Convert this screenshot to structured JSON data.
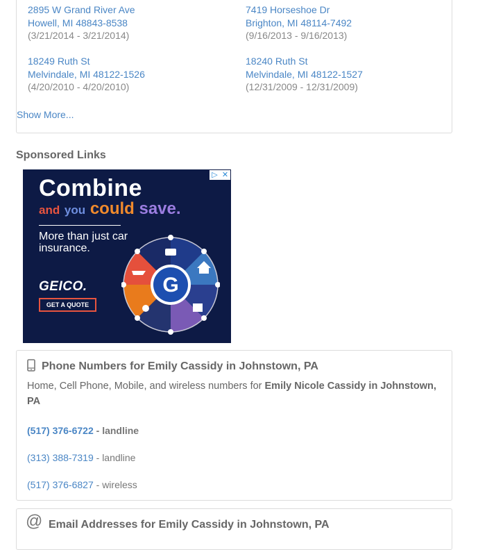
{
  "addresses": [
    {
      "street": "2895 W Grand River Ave",
      "city": "Howell, MI 48843-8538",
      "dates": "(3/21/2014 - 3/21/2014)"
    },
    {
      "street": "7419 Horseshoe Dr",
      "city": "Brighton, MI 48114-7492",
      "dates": "(9/16/2013 - 9/16/2013)"
    },
    {
      "street": "18249 Ruth St",
      "city": "Melvindale, MI 48122-1526",
      "dates": "(4/20/2010 - 4/20/2010)"
    },
    {
      "street": "18240 Ruth St",
      "city": "Melvindale, MI 48122-1527",
      "dates": "(12/31/2009 - 12/31/2009)"
    }
  ],
  "show_more": "Show More...",
  "sponsored_label": "Sponsored Links",
  "ad": {
    "headline": "Combine",
    "line2_and": "and",
    "line2_you": "you",
    "line2_could": "could",
    "line2_save": "save.",
    "sub": "More than just car insurance.",
    "logo": "GEICO",
    "logo_mark": ".",
    "cta": "GET A QUOTE",
    "wheel_center": "G",
    "choice_icon": "play-triangle-icon",
    "close_icon": "close-x-icon"
  },
  "phones": {
    "title": "Phone Numbers for Emily Cassidy in Johnstown, PA",
    "desc_prefix": "Home, Cell Phone, Mobile, and wireless numbers for ",
    "desc_name": "Emily Nicole Cassidy in Johnstown, PA",
    "items": [
      {
        "number": "(517) 376-6722",
        "type": " - landline"
      },
      {
        "number": "(313) 388-7319",
        "type": " - landline"
      },
      {
        "number": "(517) 376-6827",
        "type": " - wireless"
      }
    ]
  },
  "emails": {
    "title": "Email Addresses for Emily Cassidy in Johnstown, PA"
  },
  "colors": {
    "link": "#4a86c5",
    "ad_bg": "#0d1a45",
    "border": "#dcdcdc"
  }
}
